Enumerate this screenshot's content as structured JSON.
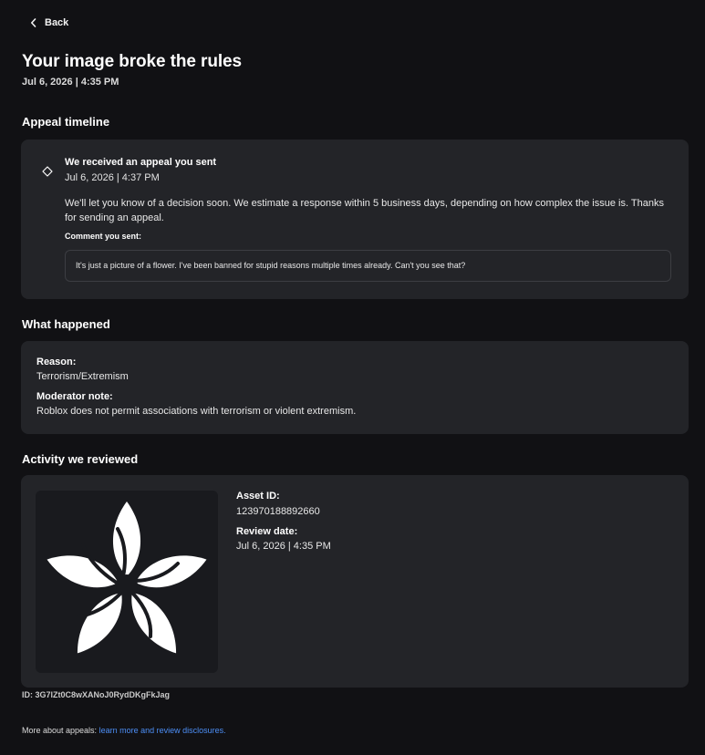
{
  "nav": {
    "back_label": "Back",
    "back_icon": "chevron-left-icon"
  },
  "header": {
    "title": "Your image broke the rules",
    "date": "Jul 6, 2026 | 4:35 PM"
  },
  "timeline": {
    "heading": "Appeal timeline",
    "event": {
      "icon": "diamond-outline-icon",
      "title": "We received an appeal you sent",
      "date": "Jul 6, 2026 | 4:37 PM",
      "body": "We'll let you know of a decision soon. We estimate a response within 5 business days, depending on how complex the issue is. Thanks for sending an appeal.",
      "comment_label": "Comment you sent:",
      "comment": "It's just a picture of a flower. I've been banned for stupid reasons multiple times already. Can't you see that?"
    }
  },
  "what_happened": {
    "heading": "What happened",
    "reason_label": "Reason:",
    "reason": "Terrorism/Extremism",
    "note_label": "Moderator note:",
    "note": "Roblox does not permit associations with terrorism or violent extremism."
  },
  "activity": {
    "heading": "Activity we reviewed",
    "thumbnail_icon": "flower-image",
    "asset_id_label": "Asset ID:",
    "asset_id": "123970188892660",
    "review_date_label": "Review date:",
    "review_date": "Jul 6, 2026 | 4:35 PM"
  },
  "footer": {
    "case_id": "ID: 3G7lZt0C8wXANoJ0RydDKgFkJag",
    "more_prefix": "More about appeals:",
    "more_link": "learn more and review disclosures."
  },
  "colors": {
    "background": "#111114",
    "card": "#232428",
    "link": "#4d8ff7"
  }
}
